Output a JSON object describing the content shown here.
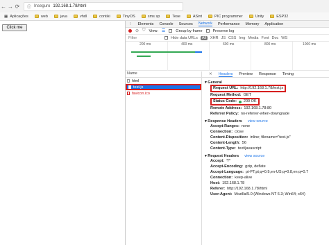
{
  "browser": {
    "address_label": "Inseguro",
    "address_url": "192.168.1.78/html"
  },
  "bookmarks": [
    {
      "label": "Aplicações"
    },
    {
      "label": "web"
    },
    {
      "label": "java"
    },
    {
      "label": "vhdl"
    },
    {
      "label": "contiki"
    },
    {
      "label": "TinyOS"
    },
    {
      "label": "sms sp"
    },
    {
      "label": "Tese"
    },
    {
      "label": "ASint"
    },
    {
      "label": "PIC programmer"
    },
    {
      "label": "Unity"
    },
    {
      "label": "ESP32"
    }
  ],
  "page": {
    "click_button_label": "Click me"
  },
  "devtools": {
    "tabs": [
      "Elements",
      "Console",
      "Sources",
      "Network",
      "Performance",
      "Memory",
      "Application"
    ],
    "active_tab": "Network",
    "toolbar": {
      "view_label": "View:",
      "group_by_frame": "Group by frame",
      "preserve_log": "Preserve log"
    },
    "filter": {
      "filter_label": "Filter",
      "hide_data_urls": "Hide data URLs",
      "types": [
        "All",
        "XHR",
        "JS",
        "CSS",
        "Img",
        "Media",
        "Font",
        "Doc",
        "WS"
      ]
    },
    "timeline_ticks": [
      "200 ms",
      "400 ms",
      "600 ms",
      "800 ms",
      "1000 ms"
    ],
    "list": {
      "header": "Name",
      "items": [
        {
          "label": "html"
        },
        {
          "label": "test.js"
        },
        {
          "label": "favicon.ico"
        }
      ]
    },
    "detail_tabs": [
      "Headers",
      "Preview",
      "Response",
      "Timing"
    ],
    "general": {
      "title": "General",
      "request_url_label": "Request URL:",
      "request_url": "http://192.168.1.78/test.js",
      "request_method_label": "Request Method:",
      "request_method": "GET",
      "status_code_label": "Status Code:",
      "status_code": "200 OK",
      "remote_address_label": "Remote Address:",
      "remote_address": "192.168.1.78:80",
      "referrer_policy_label": "Referrer Policy:",
      "referrer_policy": "no-referrer-when-downgrade"
    },
    "response_headers": {
      "title": "Response Headers",
      "view_source": "view source",
      "items": [
        {
          "k": "Accept-Ranges:",
          "v": "none"
        },
        {
          "k": "Connection:",
          "v": "close"
        },
        {
          "k": "Content-Disposition:",
          "v": "inline; filename=\"test.js\""
        },
        {
          "k": "Content-Length:",
          "v": "56"
        },
        {
          "k": "Content-Type:",
          "v": "text/javascript"
        }
      ]
    },
    "request_headers": {
      "title": "Request Headers",
      "view_source": "view source",
      "items": [
        {
          "k": "Accept:",
          "v": "*/*"
        },
        {
          "k": "Accept-Encoding:",
          "v": "gzip, deflate"
        },
        {
          "k": "Accept-Language:",
          "v": "pt-PT,pt;q=0.9,en-US;q=0.8,en;q=0.7"
        },
        {
          "k": "Connection:",
          "v": "keep-alive"
        },
        {
          "k": "Host:",
          "v": "192.168.1.78"
        },
        {
          "k": "Referer:",
          "v": "http://192.168.1.78/html"
        },
        {
          "k": "User-Agent:",
          "v": "Mozilla/5.0 (Windows NT 6.3; Win64; x64)"
        }
      ]
    }
  }
}
